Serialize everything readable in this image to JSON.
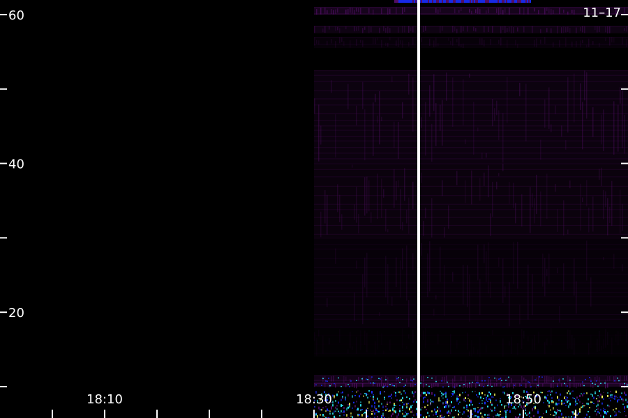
{
  "date_label": "11–17",
  "chart_data": {
    "type": "heatmap",
    "title": "",
    "xlabel": "",
    "ylabel": "",
    "x_range": [
      "18:00",
      "18:60"
    ],
    "y_range": [
      10,
      61
    ],
    "y_ticks": [
      {
        "value": 10,
        "label": ""
      },
      {
        "value": 20,
        "label": "20"
      },
      {
        "value": 30,
        "label": ""
      },
      {
        "value": 40,
        "label": "40"
      },
      {
        "value": 50,
        "label": ""
      },
      {
        "value": 60,
        "label": "60"
      }
    ],
    "x_ticks": [
      {
        "value": "18:05",
        "label": ""
      },
      {
        "value": "18:10",
        "label": "18:10"
      },
      {
        "value": "18:15",
        "label": ""
      },
      {
        "value": "18:20",
        "label": ""
      },
      {
        "value": "18:25",
        "label": ""
      },
      {
        "value": "18:30",
        "label": "18:30"
      },
      {
        "value": "18:35",
        "label": ""
      },
      {
        "value": "18:40",
        "label": ""
      },
      {
        "value": "18:45",
        "label": ""
      },
      {
        "value": "18:50",
        "label": "18:50"
      },
      {
        "value": "18:55",
        "label": ""
      }
    ],
    "signal_start": "18:30",
    "marker_time": "18:40",
    "colors": {
      "background": "#000000",
      "low": "#5a1070",
      "mid": "#1a2dff",
      "high": "#2ef0ff",
      "peak": "#ffff60",
      "marker": "#ffffff",
      "ticks": "#ffffff"
    },
    "bands": [
      {
        "y_from": 60.0,
        "y_to": 61.0,
        "level": 0.55
      },
      {
        "y_from": 57.5,
        "y_to": 58.5,
        "level": 0.35
      },
      {
        "y_from": 55.5,
        "y_to": 57.0,
        "level": 0.18
      },
      {
        "y_from": 40.0,
        "y_to": 52.5,
        "level": 0.3
      },
      {
        "y_from": 30.0,
        "y_to": 40.0,
        "level": 0.26
      },
      {
        "y_from": 18.0,
        "y_to": 30.0,
        "level": 0.18
      },
      {
        "y_from": 14.0,
        "y_to": 18.0,
        "level": 0.08
      },
      {
        "y_from": 10.5,
        "y_to": 11.5,
        "level": 0.45
      },
      {
        "y_from": 10.0,
        "y_to": 10.5,
        "level": 0.7
      }
    ]
  }
}
